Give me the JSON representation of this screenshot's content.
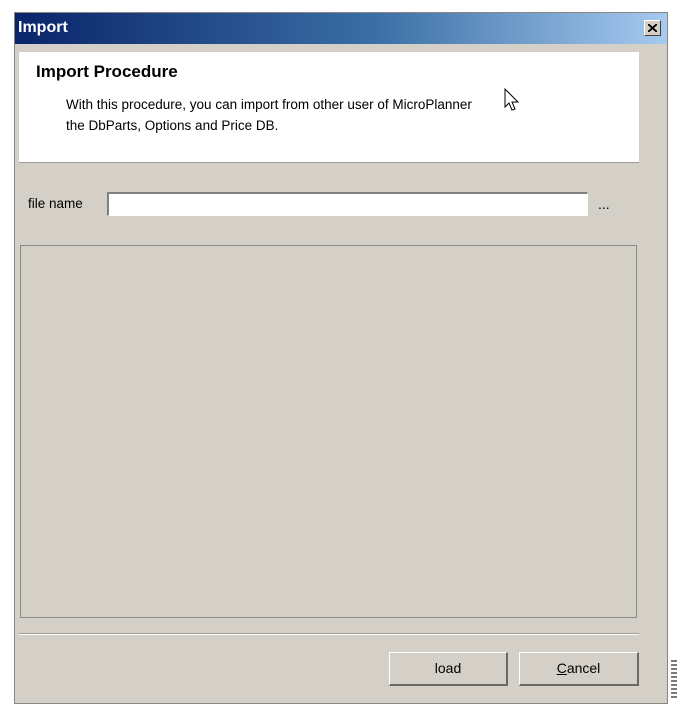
{
  "window": {
    "title": "Import",
    "close_icon": "close-icon"
  },
  "header": {
    "title": "Import Procedure",
    "description_line1": "With this procedure, you can import from other user of MicroPlanner",
    "description_line2": "the DbParts, Options and Price DB."
  },
  "file": {
    "label": "file name",
    "value": "",
    "placeholder": "",
    "browse_label": "..."
  },
  "buttons": {
    "load_label": "load",
    "cancel_label": "Cancel"
  },
  "colors": {
    "dialog_bg": "#d4d0c8",
    "titlebar_start": "#0a246a",
    "titlebar_end": "#a6caf0",
    "header_bg": "#ffffff"
  }
}
